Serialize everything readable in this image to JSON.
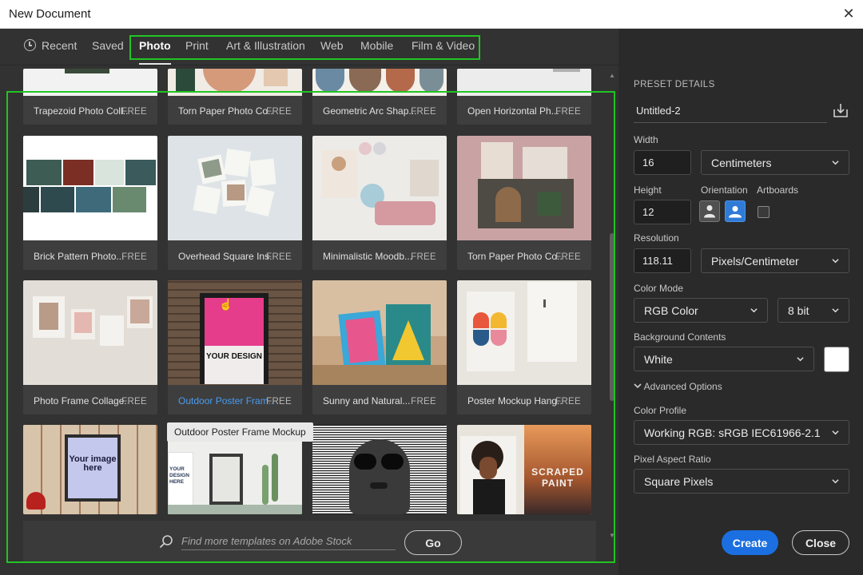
{
  "window": {
    "title": "New Document"
  },
  "tabs": [
    {
      "label": "Recent"
    },
    {
      "label": "Saved"
    },
    {
      "label": "Photo"
    },
    {
      "label": "Print"
    },
    {
      "label": "Art & Illustration"
    },
    {
      "label": "Web"
    },
    {
      "label": "Mobile"
    },
    {
      "label": "Film & Video"
    }
  ],
  "templates": [
    {
      "name": "Trapezoid Photo Coll...",
      "badge": "FREE"
    },
    {
      "name": "Torn Paper Photo Co...",
      "badge": "FREE"
    },
    {
      "name": "Geometric Arc Shap...",
      "badge": "FREE"
    },
    {
      "name": "Open Horizontal Ph...",
      "badge": "FREE"
    },
    {
      "name": "Brick Pattern Photo...",
      "badge": "FREE"
    },
    {
      "name": "Overhead Square Ins...",
      "badge": "FREE"
    },
    {
      "name": "Minimalistic Moodb...",
      "badge": "FREE"
    },
    {
      "name": "Torn Paper Photo Co...",
      "badge": "FREE"
    },
    {
      "name": "Photo Frame Collage...",
      "badge": "FREE"
    },
    {
      "name": "Outdoor Poster Fram...",
      "badge": "FREE"
    },
    {
      "name": "Sunny and Natural...",
      "badge": "FREE"
    },
    {
      "name": "Poster Mockup Hang...",
      "badge": "FREE"
    },
    {
      "thumb_text": "Your image here"
    },
    {
      "thumb_text": "YOUR DESIGN HERE"
    },
    {
      "thumb_text": ""
    },
    {
      "thumb_text": "SCRAPED PAINT"
    }
  ],
  "poster_text": "YOUR DESIGN",
  "tooltip": "Outdoor Poster Frame Mockup",
  "search": {
    "placeholder": "Find more templates on Adobe Stock",
    "go_label": "Go"
  },
  "preset": {
    "section_title": "PRESET DETAILS",
    "doc_name": "Untitled-2",
    "width_label": "Width",
    "width_value": "16",
    "width_unit": "Centimeters",
    "height_label": "Height",
    "height_value": "12",
    "orientation_label": "Orientation",
    "artboards_label": "Artboards",
    "resolution_label": "Resolution",
    "resolution_value": "118.11",
    "resolution_unit": "Pixels/Centimeter",
    "color_mode_label": "Color Mode",
    "color_mode": "RGB Color",
    "bit_depth": "8 bit",
    "background_label": "Background Contents",
    "background": "White",
    "advanced_label": "Advanced Options",
    "color_profile_label": "Color Profile",
    "color_profile": "Working RGB: sRGB IEC61966-2.1",
    "pixel_aspect_label": "Pixel Aspect Ratio",
    "pixel_aspect": "Square Pixels",
    "create_label": "Create",
    "close_label": "Close"
  },
  "colors": {
    "accent": "#1b6fe0",
    "highlight_box": "#22c422",
    "link": "#4a9cf0"
  }
}
